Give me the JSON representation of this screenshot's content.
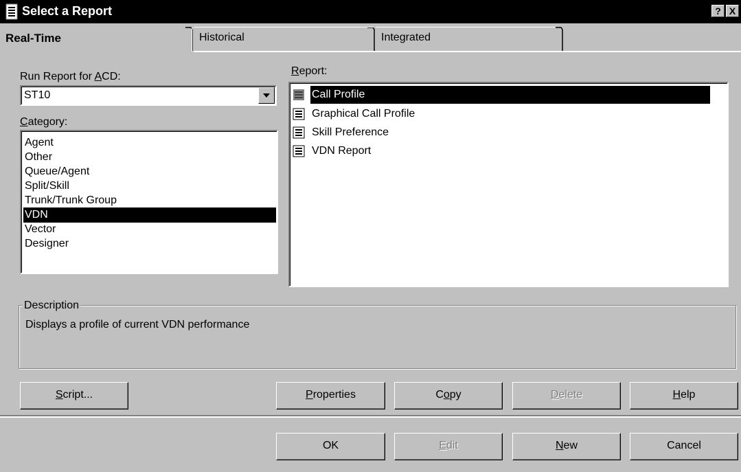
{
  "window": {
    "title": "Select a Report",
    "help_button": "?",
    "close_button": "X",
    "icon": "report-icon"
  },
  "tabs": [
    {
      "label": "Real-Time",
      "active": true
    },
    {
      "label": "Historical",
      "active": false
    },
    {
      "label": "Integrated",
      "active": false
    }
  ],
  "acd": {
    "label_prefix": "Run Report for ",
    "label_hotkey": "A",
    "label_suffix": "CD:",
    "value": "ST10"
  },
  "category": {
    "label_hotkey": "C",
    "label_rest": "ategory:",
    "items": [
      "Agent",
      "Other",
      "Queue/Agent",
      "Split/Skill",
      "Trunk/Trunk Group",
      "VDN",
      "Vector",
      "Designer"
    ],
    "selected": "VDN"
  },
  "report": {
    "label_hotkey": "R",
    "label_rest": "eport:",
    "items": [
      "Call Profile",
      "Graphical Call Profile",
      "Skill Preference",
      "VDN Report"
    ],
    "selected": "Call Profile"
  },
  "description": {
    "label": "Description",
    "text": "Displays a profile of current VDN performance"
  },
  "buttons": {
    "script": {
      "hotkey": "S",
      "rest": "cript..."
    },
    "properties": {
      "hotkey": "P",
      "rest": "roperties"
    },
    "copy": {
      "pre": "C",
      "hotkey": "o",
      "rest": "py"
    },
    "delete": {
      "hotkey": "D",
      "rest": "elete",
      "disabled": true
    },
    "help": {
      "hotkey": "H",
      "rest": "elp"
    },
    "ok": {
      "label": "OK"
    },
    "edit": {
      "hotkey": "E",
      "rest": "dit",
      "disabled": true
    },
    "new": {
      "hotkey": "N",
      "rest": "ew"
    },
    "cancel": {
      "label": "Cancel"
    }
  },
  "colors": {
    "title_bar": "#000000",
    "face": "#c0c0c0",
    "selection": "#000000",
    "disabled_text": "#808080"
  }
}
